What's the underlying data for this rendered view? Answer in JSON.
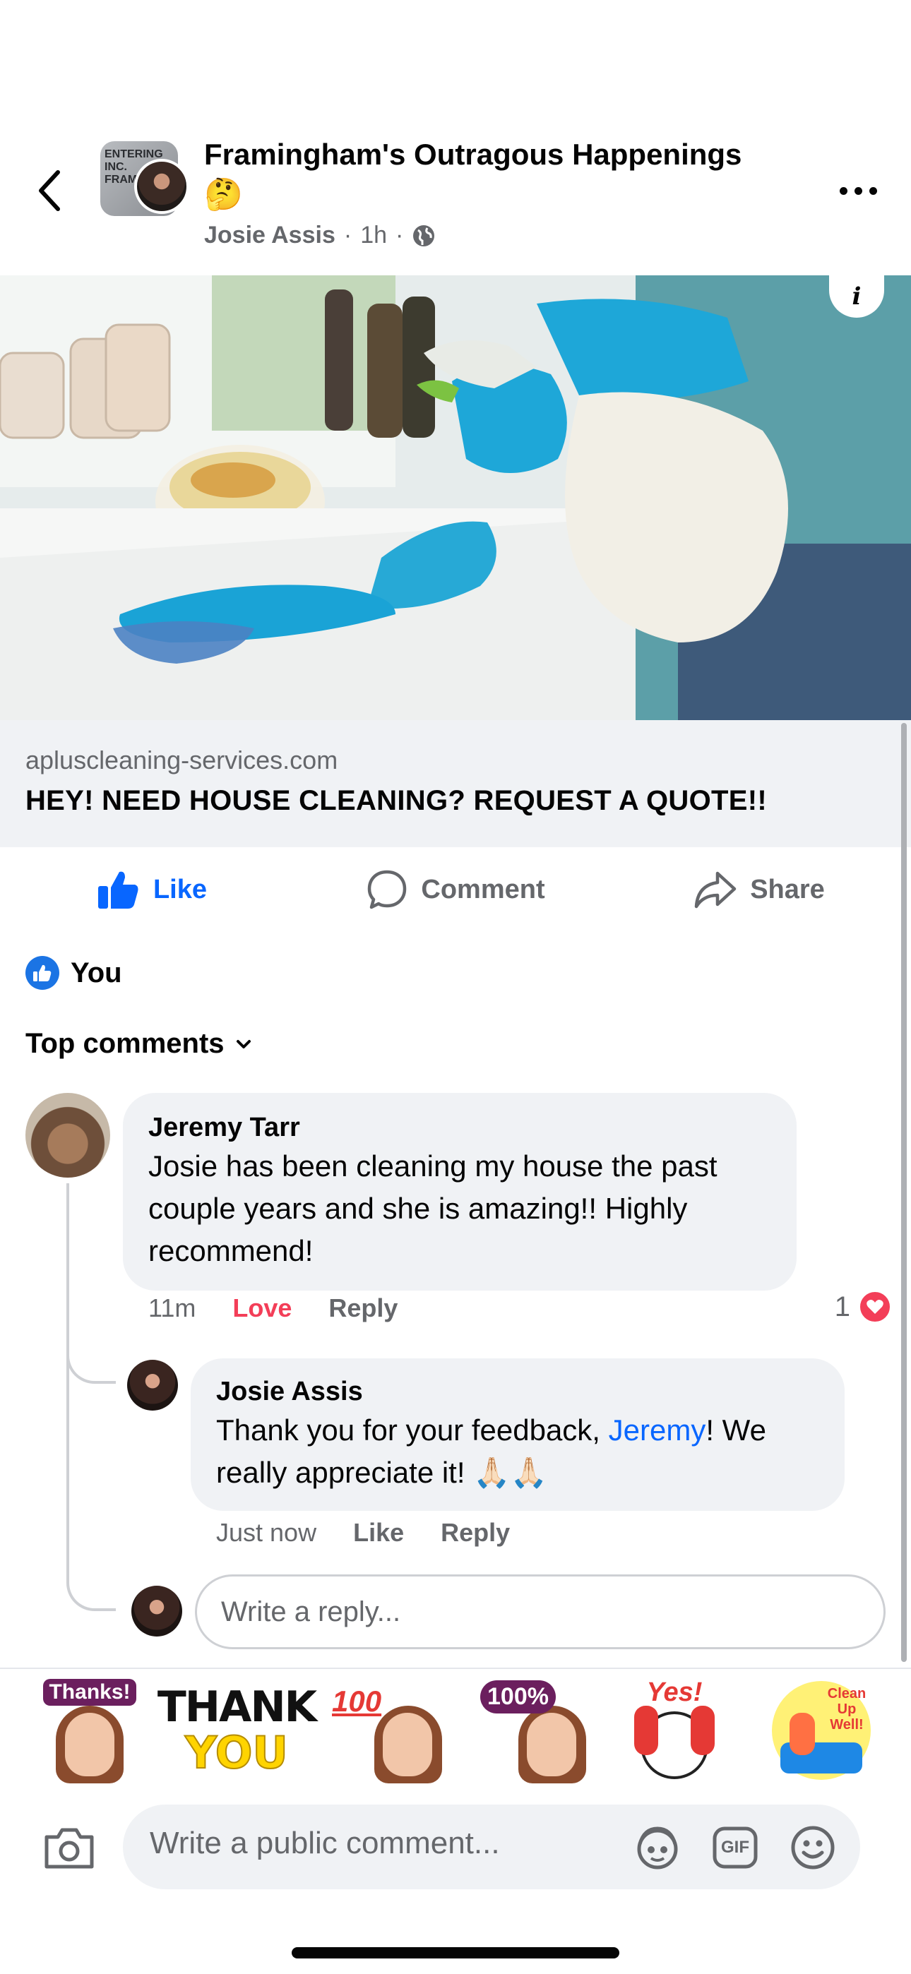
{
  "header": {
    "group_name": "Framingham's Outragous Happenings",
    "title_emoji": "🤔",
    "author": "Josie Assis",
    "dot1": "·",
    "time": "1h",
    "dot2": "·",
    "privacy_icon": "globe-icon",
    "group_avatar_sign": "ENTERING\nINC.\nFRAM"
  },
  "ad": {
    "info_label": "i",
    "domain": "apluscleaning-services.com",
    "headline": "HEY! NEED HOUSE CLEANING? REQUEST A QUOTE!!"
  },
  "actions": {
    "like": "Like",
    "comment": "Comment",
    "share": "Share"
  },
  "reactions": {
    "label": "You"
  },
  "comments_sort": "Top comments",
  "comments": [
    {
      "author": "Jeremy Tarr",
      "text": "Josie has been cleaning my house the past couple years and she is amazing!! Highly recommend!",
      "time": "11m",
      "reaction_action": "Love",
      "reply_label": "Reply",
      "reaction_count": "1"
    },
    {
      "author": "Josie Assis",
      "text_before": "Thank you for your feedback, ",
      "mention": "Jeremy",
      "text_after": "! We really appreciate it! 🙏🏻🙏🏻",
      "time": "Just now",
      "like_label": "Like",
      "reply_label": "Reply"
    }
  ],
  "reply_placeholder": "Write a reply...",
  "stickers": [
    {
      "name": "thanks-sticker",
      "label": "Thanks!"
    },
    {
      "name": "thank-you-sticker",
      "label_top": "THANK",
      "label_bottom": "YOU"
    },
    {
      "name": "100-thumbs-sticker",
      "label": "100"
    },
    {
      "name": "100-percent-sticker",
      "label": "100%"
    },
    {
      "name": "yes-sticker",
      "label": "Yes!"
    },
    {
      "name": "clean-up-well-sticker",
      "label": "Clean Up Well!"
    }
  ],
  "composer": {
    "placeholder": "Write a public comment...",
    "gif_label": "GIF"
  },
  "colors": {
    "accent_blue": "#0866ff",
    "love_red": "#f33e58",
    "secondary_text": "#65676b",
    "bubble_bg": "#f0f2f5"
  }
}
